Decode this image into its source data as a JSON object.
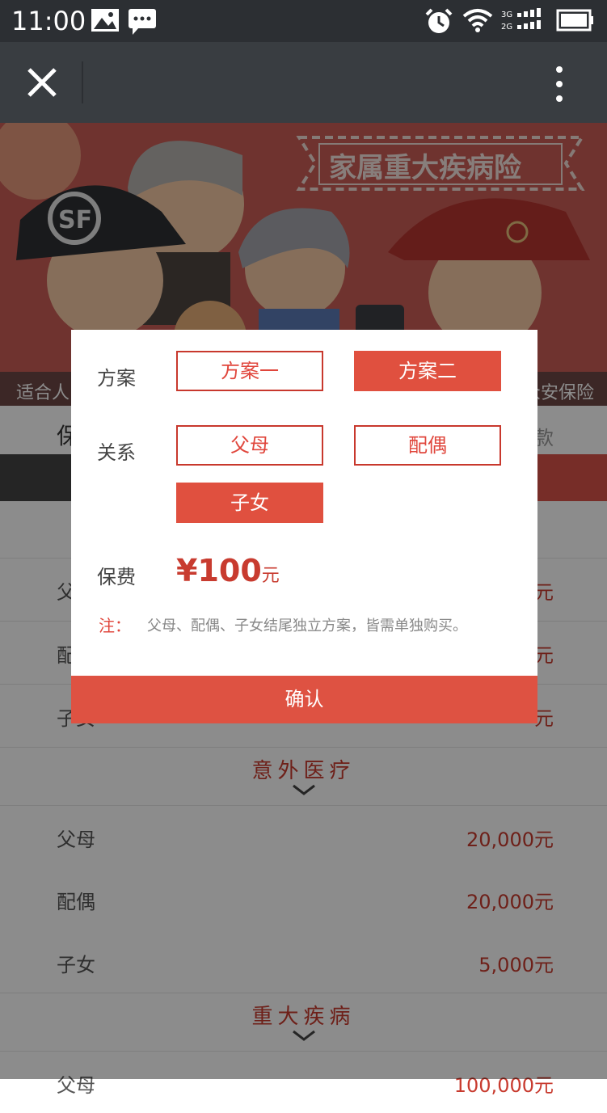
{
  "status_bar": {
    "time": "11:00"
  },
  "banner": {
    "title": "家属重大疾病险",
    "caption_left": "适合人",
    "caption_right": "众安保险"
  },
  "page": {
    "tab_left": "保",
    "tab_right": "款",
    "rows_top": [
      {
        "label": "父母",
        "value": "元"
      },
      {
        "label": "配偶",
        "value": "元"
      },
      {
        "label": "子女",
        "value": "元"
      }
    ],
    "section1": {
      "title": "意外医疗",
      "rows": [
        {
          "label": "父母",
          "value": "20,000元"
        },
        {
          "label": "配偶",
          "value": "20,000元"
        },
        {
          "label": "子女",
          "value": "5,000元"
        }
      ]
    },
    "section2": {
      "title": "重大疾病",
      "rows": [
        {
          "label": "父母",
          "value": "100,000元"
        }
      ]
    }
  },
  "modal": {
    "plan_label": "方案",
    "plan_options": [
      "方案一",
      "方案二"
    ],
    "relation_label": "关系",
    "relation_options": [
      "父母",
      "配偶",
      "子女"
    ],
    "fee_label": "保费",
    "price_amount": "¥100",
    "price_unit": "元",
    "note_label": "注：",
    "note_text": "父母、配偶、子女结尾独立方案，皆需单独购买。",
    "confirm_label": "确认"
  },
  "colors": {
    "accent": "#de5242",
    "nav": "#393d41"
  }
}
